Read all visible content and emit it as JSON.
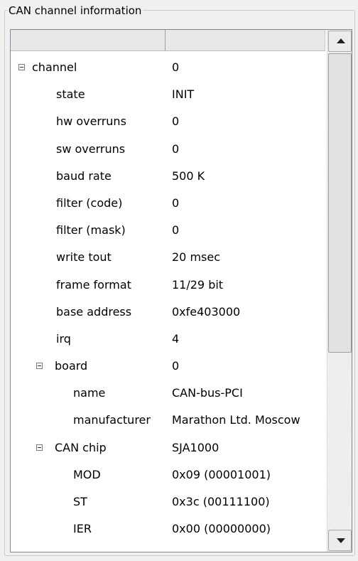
{
  "group": {
    "title": "CAN channel information"
  },
  "tree": {
    "columns": [
      "",
      ""
    ],
    "rows": [
      {
        "name": "channel",
        "value": "0",
        "level": 0,
        "expanded": true
      },
      {
        "name": "state",
        "value": "INIT",
        "level": 1
      },
      {
        "name": "hw overruns",
        "value": "0",
        "level": 1
      },
      {
        "name": "sw overruns",
        "value": "0",
        "level": 1
      },
      {
        "name": "baud rate",
        "value": "500 K",
        "level": 1
      },
      {
        "name": "filter (code)",
        "value": "0",
        "level": 1
      },
      {
        "name": "filter (mask)",
        "value": "0",
        "level": 1
      },
      {
        "name": "write tout",
        "value": "20 msec",
        "level": 1
      },
      {
        "name": "frame format",
        "value": "11/29 bit",
        "level": 1
      },
      {
        "name": "base address",
        "value": "0xfe403000",
        "level": 1
      },
      {
        "name": "irq",
        "value": "4",
        "level": 1
      },
      {
        "name": "board",
        "value": "0",
        "level": 1,
        "expanded": true
      },
      {
        "name": "name",
        "value": "CAN-bus-PCI",
        "level": 2
      },
      {
        "name": "manufacturer",
        "value": "Marathon Ltd. Moscow",
        "level": 2
      },
      {
        "name": "CAN chip",
        "value": "SJA1000",
        "level": 1,
        "expanded": true
      },
      {
        "name": "MOD",
        "value": "0x09 (00001001)",
        "level": 2
      },
      {
        "name": "ST",
        "value": "0x3c (00111100)",
        "level": 2
      },
      {
        "name": "IER",
        "value": "0x00 (00000000)",
        "level": 2
      }
    ]
  },
  "scrollbar": {
    "up_icon": "arrow-up-icon",
    "down_icon": "arrow-down-icon",
    "position": 0.0
  }
}
